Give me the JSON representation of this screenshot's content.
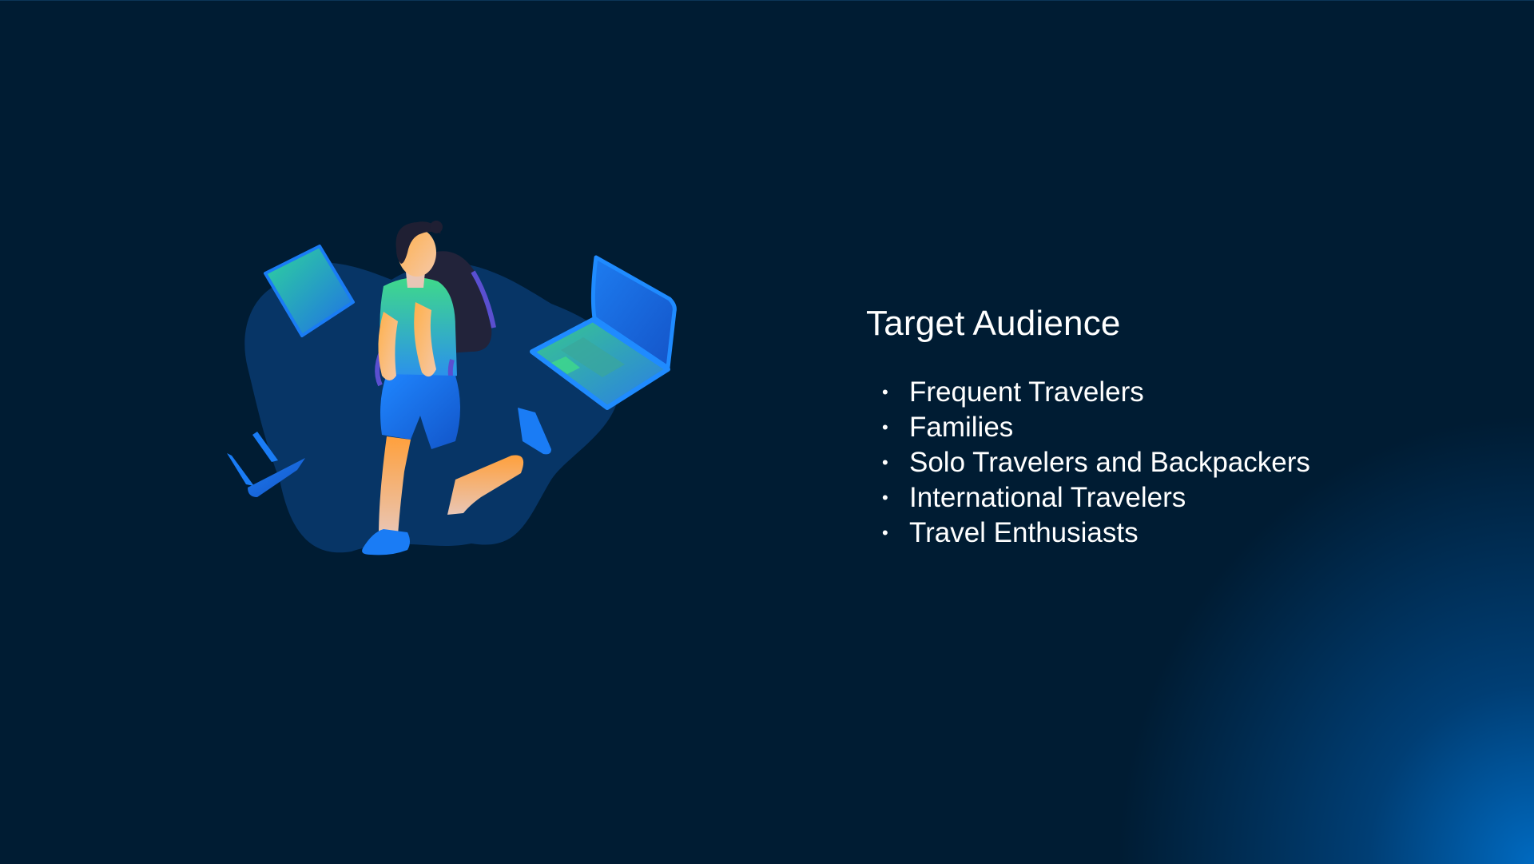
{
  "slide": {
    "title": "Target Audience",
    "bullet_symbol": "•",
    "items": [
      {
        "label": "Frequent Travelers"
      },
      {
        "label": "Families"
      },
      {
        "label": "Solo Travelers and Backpackers"
      },
      {
        "label": "International Travelers"
      },
      {
        "label": "Travel Enthusiasts"
      }
    ]
  },
  "illustration": {
    "icon": "traveler-with-backpack-and-laptops-icon"
  },
  "colors": {
    "background": "#001c33",
    "corner_glow": "#006ec8",
    "blob": "#073566",
    "accent_blue": "#1a7cf5",
    "accent_green": "#3fd98a",
    "skin_orange": "#ffa03c",
    "text": "#ffffff"
  }
}
